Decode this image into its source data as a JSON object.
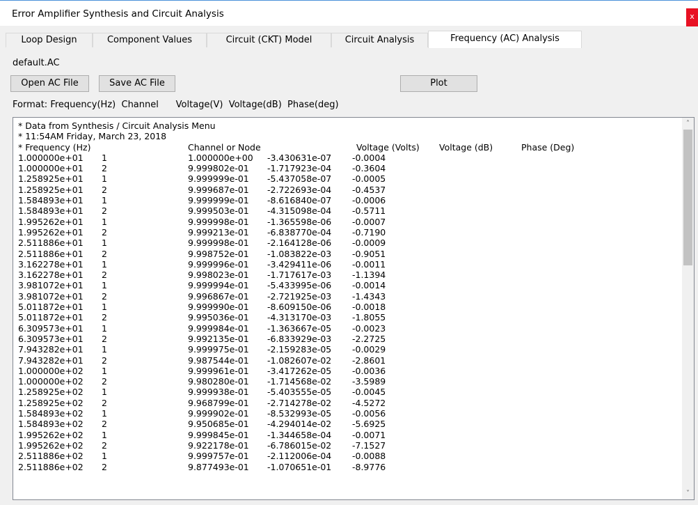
{
  "window": {
    "title": "Error Amplifier Synthesis and Circuit Analysis",
    "close_glyph": "x"
  },
  "tabs": [
    {
      "label": "Loop Design"
    },
    {
      "label": "Component Values"
    },
    {
      "label": "Circuit (CKT) Model"
    },
    {
      "label": "Circuit Analysis"
    },
    {
      "label": "Frequency (AC) Analysis"
    }
  ],
  "active_tab": 4,
  "panel": {
    "filename": "default.AC",
    "open_label": "Open AC File",
    "save_label": "Save AC File",
    "plot_label": "Plot",
    "format_line": "Format: Frequency(Hz)  Channel      Voltage(V)  Voltage(dB)  Phase(deg)"
  },
  "data_text": {
    "header": [
      "* Data from Synthesis / Circuit Analysis Menu",
      "* 11:54AM Friday, March 23, 2018"
    ],
    "columns": [
      "* Frequency (Hz)",
      "Channel or Node",
      "Voltage (Volts)",
      "Voltage (dB)",
      "Phase (Deg)"
    ],
    "rows": [
      [
        "1.000000e+01",
        "1",
        "1.000000e+00",
        "-3.430631e-07",
        "-0.0004"
      ],
      [
        "1.000000e+01",
        "2",
        "9.999802e-01",
        "-1.717923e-04",
        "-0.3604"
      ],
      [
        "1.258925e+01",
        "1",
        "9.999999e-01",
        "-5.437058e-07",
        "-0.0005"
      ],
      [
        "1.258925e+01",
        "2",
        "9.999687e-01",
        "-2.722693e-04",
        "-0.4537"
      ],
      [
        "1.584893e+01",
        "1",
        "9.999999e-01",
        "-8.616840e-07",
        "-0.0006"
      ],
      [
        "1.584893e+01",
        "2",
        "9.999503e-01",
        "-4.315098e-04",
        "-0.5711"
      ],
      [
        "1.995262e+01",
        "1",
        "9.999998e-01",
        "-1.365598e-06",
        "-0.0007"
      ],
      [
        "1.995262e+01",
        "2",
        "9.999213e-01",
        "-6.838770e-04",
        "-0.7190"
      ],
      [
        "2.511886e+01",
        "1",
        "9.999998e-01",
        "-2.164128e-06",
        "-0.0009"
      ],
      [
        "2.511886e+01",
        "2",
        "9.998752e-01",
        "-1.083822e-03",
        "-0.9051"
      ],
      [
        "3.162278e+01",
        "1",
        "9.999996e-01",
        "-3.429411e-06",
        "-0.0011"
      ],
      [
        "3.162278e+01",
        "2",
        "9.998023e-01",
        "-1.717617e-03",
        "-1.1394"
      ],
      [
        "3.981072e+01",
        "1",
        "9.999994e-01",
        "-5.433995e-06",
        "-0.0014"
      ],
      [
        "3.981072e+01",
        "2",
        "9.996867e-01",
        "-2.721925e-03",
        "-1.4343"
      ],
      [
        "5.011872e+01",
        "1",
        "9.999990e-01",
        "-8.609150e-06",
        "-0.0018"
      ],
      [
        "5.011872e+01",
        "2",
        "9.995036e-01",
        "-4.313170e-03",
        "-1.8055"
      ],
      [
        "6.309573e+01",
        "1",
        "9.999984e-01",
        "-1.363667e-05",
        "-0.0023"
      ],
      [
        "6.309573e+01",
        "2",
        "9.992135e-01",
        "-6.833929e-03",
        "-2.2725"
      ],
      [
        "7.943282e+01",
        "1",
        "9.999975e-01",
        "-2.159283e-05",
        "-0.0029"
      ],
      [
        "7.943282e+01",
        "2",
        "9.987544e-01",
        "-1.082607e-02",
        "-2.8601"
      ],
      [
        "1.000000e+02",
        "1",
        "9.999961e-01",
        "-3.417262e-05",
        "-0.0036"
      ],
      [
        "1.000000e+02",
        "2",
        "9.980280e-01",
        "-1.714568e-02",
        "-3.5989"
      ],
      [
        "1.258925e+02",
        "1",
        "9.999938e-01",
        "-5.403555e-05",
        "-0.0045"
      ],
      [
        "1.258925e+02",
        "2",
        "9.968799e-01",
        "-2.714278e-02",
        "-4.5272"
      ],
      [
        "1.584893e+02",
        "1",
        "9.999902e-01",
        "-8.532993e-05",
        "-0.0056"
      ],
      [
        "1.584893e+02",
        "2",
        "9.950685e-01",
        "-4.294014e-02",
        "-5.6925"
      ],
      [
        "1.995262e+02",
        "1",
        "9.999845e-01",
        "-1.344658e-04",
        "-0.0071"
      ],
      [
        "1.995262e+02",
        "2",
        "9.922178e-01",
        "-6.786015e-02",
        "-7.1527"
      ],
      [
        "2.511886e+02",
        "1",
        "9.999757e-01",
        "-2.112006e-04",
        "-0.0088"
      ],
      [
        "2.511886e+02",
        "2",
        "9.877493e-01",
        "-1.070651e-01",
        "-8.9776"
      ]
    ]
  },
  "scrollbar": {
    "up_glyph": "˄",
    "down_glyph": "˅",
    "position": 0
  }
}
